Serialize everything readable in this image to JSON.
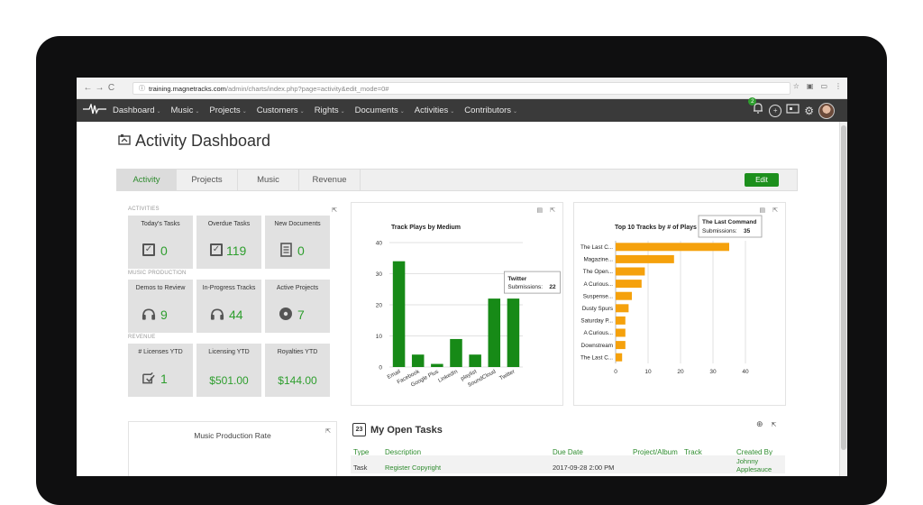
{
  "browser": {
    "url_host": "training.magnetracks.com",
    "url_path": "/admin/charts/index.php?page=activity&edit_mode=0#"
  },
  "nav": {
    "items": [
      "Dashboard",
      "Music",
      "Projects",
      "Customers",
      "Rights",
      "Documents",
      "Activities",
      "Contributors"
    ],
    "notification_count": "2"
  },
  "page": {
    "title": "Activity Dashboard"
  },
  "tabs": [
    "Activity",
    "Projects",
    "Music",
    "Revenue"
  ],
  "edit_label": "Edit",
  "stats": {
    "activities_label": "ACTIVITIES",
    "music_label": "MUSIC PRODUCTION",
    "revenue_label": "REVENUE",
    "activities": [
      {
        "label": "Today's Tasks",
        "value": "0",
        "icon": "check-icon"
      },
      {
        "label": "Overdue Tasks",
        "value": "119",
        "icon": "check-icon"
      },
      {
        "label": "New Documents",
        "value": "0",
        "icon": "document-icon"
      }
    ],
    "music": [
      {
        "label": "Demos to Review",
        "value": "9",
        "icon": "headphones-icon"
      },
      {
        "label": "In-Progress Tracks",
        "value": "44",
        "icon": "headphones-icon"
      },
      {
        "label": "Active Projects",
        "value": "7",
        "icon": "disc-icon"
      }
    ],
    "revenue": [
      {
        "label": "# Licenses YTD",
        "value": "1",
        "icon": "license-icon"
      },
      {
        "label": "Licensing YTD",
        "value": "$501.00",
        "icon": ""
      },
      {
        "label": "Royalties YTD",
        "value": "$144.00",
        "icon": ""
      }
    ]
  },
  "chart_data": [
    {
      "type": "bar",
      "title": "Track Plays by Medium",
      "categories": [
        "Email",
        "Facebook",
        "Google Plus",
        "LinkedIn",
        "playlist",
        "SoundCloud",
        "Twitter"
      ],
      "values": [
        34,
        4,
        1,
        9,
        4,
        22,
        22
      ],
      "ylim": [
        0,
        40
      ],
      "yticks": [
        0,
        10,
        20,
        30,
        40
      ],
      "color": "#178a17",
      "grid": true,
      "tooltip": {
        "title": "Twitter",
        "label": "Submissions:",
        "value": "22"
      }
    },
    {
      "type": "bar",
      "orientation": "horizontal",
      "title": "Top 10 Tracks by # of Plays",
      "categories": [
        "The Last C...",
        "Magazine...",
        "The Open...",
        "A Curious...",
        "Suspense...",
        "Dusty Spurs",
        "Saturday P...",
        "A Curious...",
        "Downstream",
        "The Last C..."
      ],
      "values": [
        35,
        18,
        9,
        8,
        5,
        4,
        3,
        3,
        3,
        2
      ],
      "xlim": [
        0,
        45
      ],
      "xticks": [
        0,
        10,
        20,
        30,
        40
      ],
      "color": "#f5a10c",
      "grid": true,
      "tooltip": {
        "title": "The Last Command",
        "label": "Submissions:",
        "value": "35"
      }
    }
  ],
  "production": {
    "title": "Music Production Rate"
  },
  "tasks": {
    "title": "My Open Tasks",
    "calendar_day": "23",
    "headers": [
      "Type",
      "Description",
      "Due Date",
      "Project/Album",
      "Track",
      "Created By"
    ],
    "rows": [
      {
        "type": "Task",
        "description": "Register Copyright",
        "due": "2017-09-28 2:00 PM",
        "project": "",
        "track": "",
        "created_by_1": "Johnny",
        "created_by_2": "Applesauce"
      }
    ]
  }
}
